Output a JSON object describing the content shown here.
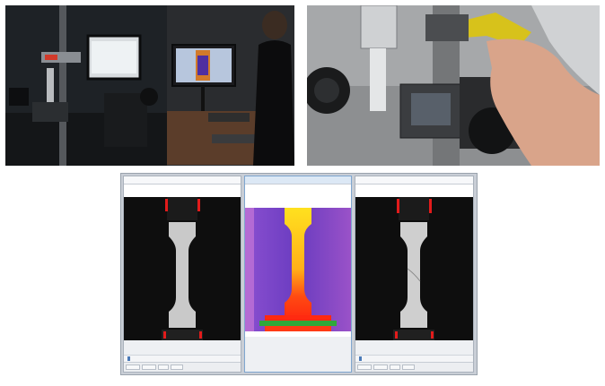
{
  "scene": {
    "left_photo": "lab-workstation",
    "right_photo": "handheld-infrared-camera",
    "composite": "three-window-thermal-comparison"
  },
  "colors": {
    "ir_background": "#7b47c4",
    "ir_hot": "#ff2a10",
    "ir_warm": "#ffd21a",
    "specimen_gray": "#c9c9c9",
    "grip_red": "#e21b1b"
  },
  "icons": [
    "grip-marker-icon",
    "slider-thumb-icon"
  ]
}
